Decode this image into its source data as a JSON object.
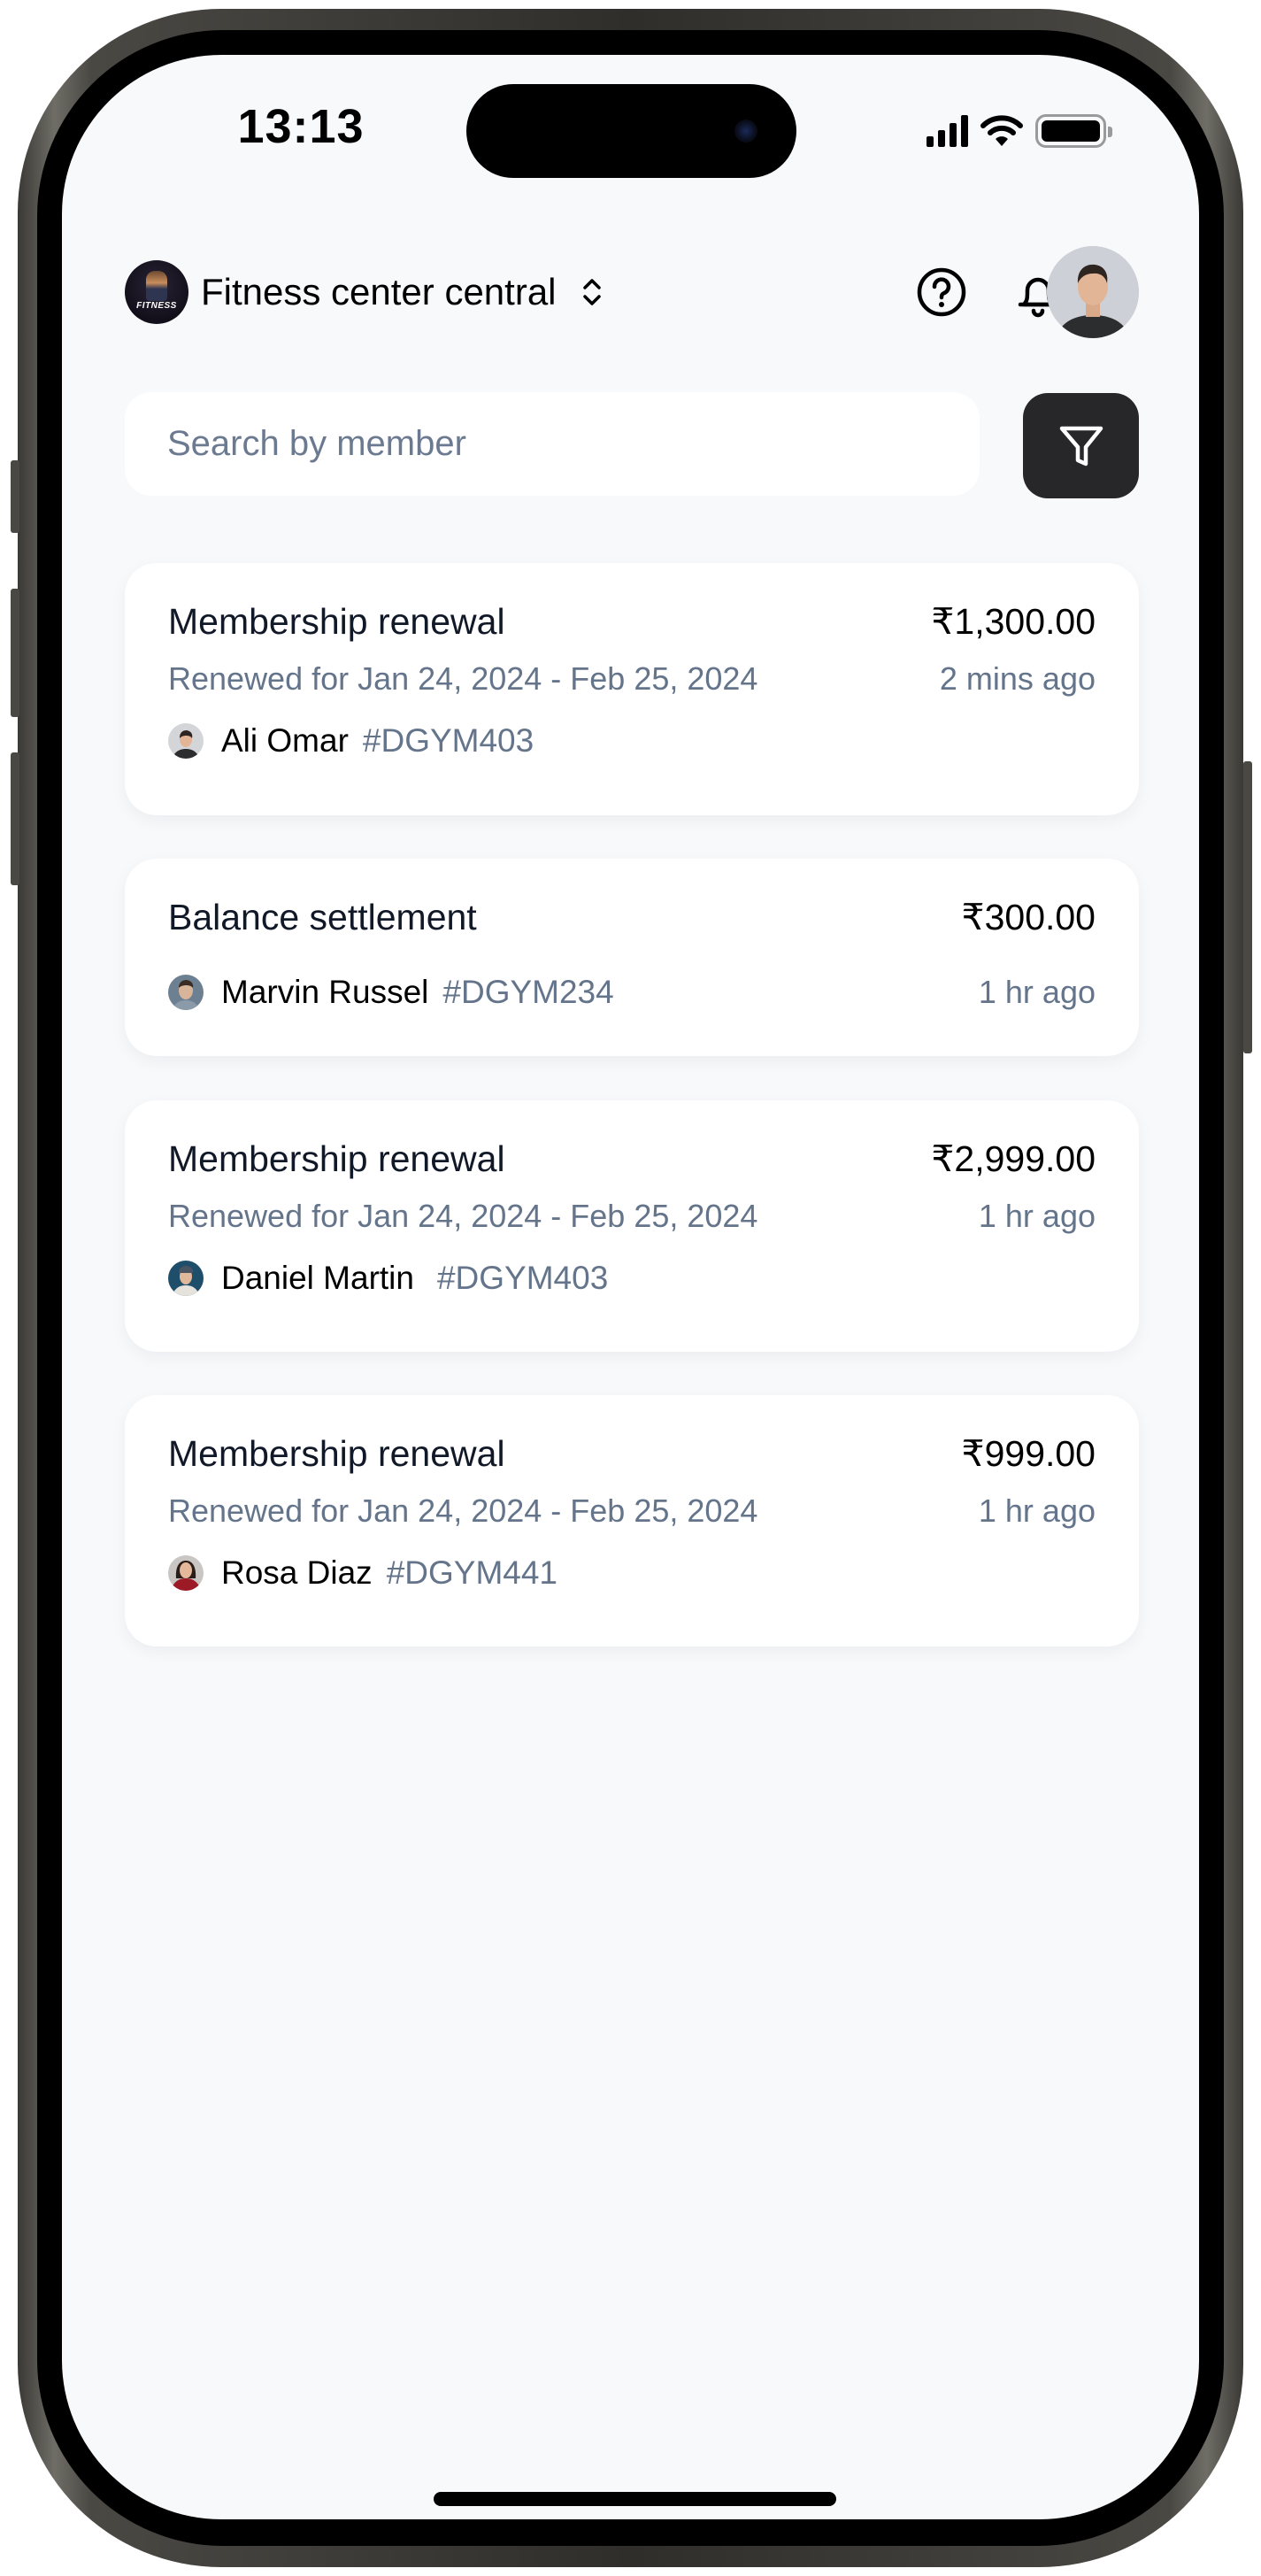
{
  "status_bar": {
    "time": "13:13",
    "icons": [
      "cellular-signal-icon",
      "wifi-icon",
      "battery-icon"
    ],
    "battery_level": 1.0
  },
  "header": {
    "org_logo_text": "FITNESS",
    "org_name": "Fitness center central",
    "org_selector_icon": "chevron-up-down-icon",
    "help_icon": "help-circle-icon",
    "notifications_icon": "bell-icon",
    "profile_avatar": "user-avatar"
  },
  "search": {
    "placeholder": "Search by member",
    "value": "",
    "filter_icon": "filter-funnel-icon"
  },
  "colors": {
    "background": "#f8f9fb",
    "card": "#ffffff",
    "filter_button": "#27272a",
    "primary_text": "#111827",
    "secondary_text": "#64748b"
  },
  "transactions": [
    {
      "title": "Membership renewal",
      "amount": "₹1,300.00",
      "period": "Renewed for Jan 24,  2024 - Feb 25, 2024",
      "time_ago": "2 mins ago",
      "member_name": "Ali Omar",
      "member_id": "#DGYM403"
    },
    {
      "title": "Balance settlement",
      "amount": "₹300.00",
      "period": null,
      "time_ago": "1 hr ago",
      "member_name": "Marvin Russel",
      "member_id": "#DGYM234"
    },
    {
      "title": "Membership renewal",
      "amount": "₹2,999.00",
      "period": "Renewed for Jan 24, 2024 - Feb 25, 2024",
      "time_ago": "1 hr ago",
      "member_name": "Daniel Martin",
      "member_id": "#DGYM403"
    },
    {
      "title": "Membership renewal",
      "amount": "₹999.00",
      "period": "Renewed for Jan 24, 2024 - Feb 25, 2024",
      "time_ago": "1 hr ago",
      "member_name": "Rosa Diaz",
      "member_id": "#DGYM441"
    }
  ]
}
